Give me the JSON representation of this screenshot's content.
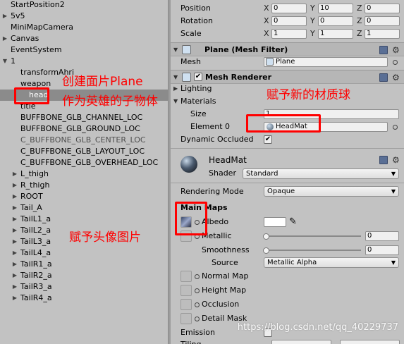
{
  "hierarchy": {
    "items": [
      {
        "label": "StartPosition2",
        "arrow": "",
        "grey": false
      },
      {
        "label": "5v5",
        "arrow": "▶",
        "grey": false
      },
      {
        "label": "MiniMapCamera",
        "arrow": "",
        "grey": false
      },
      {
        "label": "Canvas",
        "arrow": "▶",
        "grey": false
      },
      {
        "label": "EventSystem",
        "arrow": "",
        "grey": false
      },
      {
        "label": "1",
        "arrow": "▼",
        "grey": false
      },
      {
        "label": "transformAhri",
        "arrow": "",
        "grey": false
      },
      {
        "label": "weapon",
        "arrow": "",
        "grey": false
      },
      {
        "label": "head",
        "arrow": "",
        "grey": false,
        "selected": true
      },
      {
        "label": "title",
        "arrow": "",
        "grey": false
      },
      {
        "label": "BUFFBONE_GLB_CHANNEL_LOC",
        "arrow": "",
        "grey": false
      },
      {
        "label": "BUFFBONE_GLB_GROUND_LOC",
        "arrow": "",
        "grey": false
      },
      {
        "label": "C_BUFFBONE_GLB_CENTER_LOC",
        "arrow": "",
        "grey": true
      },
      {
        "label": "C_BUFFBONE_GLB_LAYOUT_LOC",
        "arrow": "",
        "grey": false
      },
      {
        "label": "C_BUFFBONE_GLB_OVERHEAD_LOC",
        "arrow": "",
        "grey": false
      },
      {
        "label": "L_thigh",
        "arrow": "▶",
        "grey": false
      },
      {
        "label": "R_thigh",
        "arrow": "▶",
        "grey": false
      },
      {
        "label": "ROOT",
        "arrow": "▶",
        "grey": false
      },
      {
        "label": "Tail_A",
        "arrow": "▶",
        "grey": false
      },
      {
        "label": "TailL1_a",
        "arrow": "▶",
        "grey": false
      },
      {
        "label": "TailL2_a",
        "arrow": "▶",
        "grey": false
      },
      {
        "label": "TailL3_a",
        "arrow": "▶",
        "grey": false
      },
      {
        "label": "TailL4_a",
        "arrow": "▶",
        "grey": false
      },
      {
        "label": "TailR1_a",
        "arrow": "▶",
        "grey": false
      },
      {
        "label": "TailR2_a",
        "arrow": "▶",
        "grey": false
      },
      {
        "label": "TailR3_a",
        "arrow": "▶",
        "grey": false
      },
      {
        "label": "TailR4_a",
        "arrow": "▶",
        "grey": false
      }
    ]
  },
  "transform": {
    "position": {
      "label": "Position",
      "x": "0",
      "y": "10",
      "z": "0"
    },
    "rotation": {
      "label": "Rotation",
      "x": "0",
      "y": "0",
      "z": "0"
    },
    "scale": {
      "label": "Scale",
      "x": "1",
      "y": "1",
      "z": "1"
    },
    "axis_x": "X",
    "axis_y": "Y",
    "axis_z": "Z"
  },
  "mesh_filter": {
    "title": "Plane (Mesh Filter)",
    "mesh_label": "Mesh",
    "mesh_value": "Plane"
  },
  "mesh_renderer": {
    "title": "Mesh Renderer",
    "enabled": true,
    "lighting": "Lighting",
    "materials": "Materials",
    "size_label": "Size",
    "size_value": "1",
    "element_label": "Element 0",
    "element_value": "HeadMat",
    "dynamic_occluded": "Dynamic Occluded"
  },
  "material": {
    "name": "HeadMat",
    "shader_label": "Shader",
    "shader_value": "Standard",
    "rendering_mode_label": "Rendering Mode",
    "rendering_mode_value": "Opaque",
    "main_maps": "Main Maps",
    "albedo": "Albedo",
    "metallic": "Metallic",
    "metallic_value": "0",
    "smoothness": "Smoothness",
    "smoothness_value": "0",
    "source_label": "Source",
    "source_value": "Metallic Alpha",
    "normal_map": "Normal Map",
    "height_map": "Height Map",
    "occlusion": "Occlusion",
    "detail_mask": "Detail Mask",
    "emission": "Emission",
    "tiling": "Tiling"
  },
  "annotations": {
    "create_plane": "创建面片Plane",
    "as_child": "作为英雄的子物体",
    "assign_material": "赋予新的材质球",
    "assign_avatar": "赋予头像图片"
  },
  "watermark": "https://blog.csdn.net/qq_40229737",
  "colors": {
    "annotation": "#ff0000",
    "selection": "#8b8b8b",
    "panel": "#c2c2c2"
  }
}
